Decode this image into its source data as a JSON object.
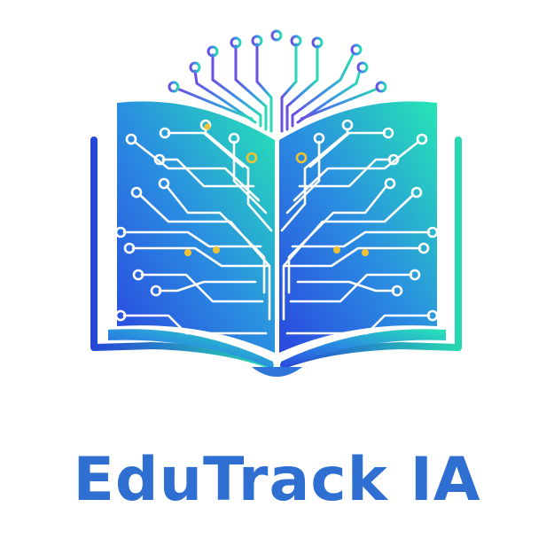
{
  "brand": {
    "name": "EduTrack IA",
    "text_color": "#2f6fd2"
  },
  "logo": {
    "icon": "open-book-circuit-tree-icon",
    "colors": {
      "gradient_start": "#2a47df",
      "gradient_mid": "#2a8fe0",
      "gradient_end": "#26e6b4",
      "circuit_line": "#ffffff",
      "node_accent": "#f1c232",
      "outline": "#2757d8"
    }
  }
}
